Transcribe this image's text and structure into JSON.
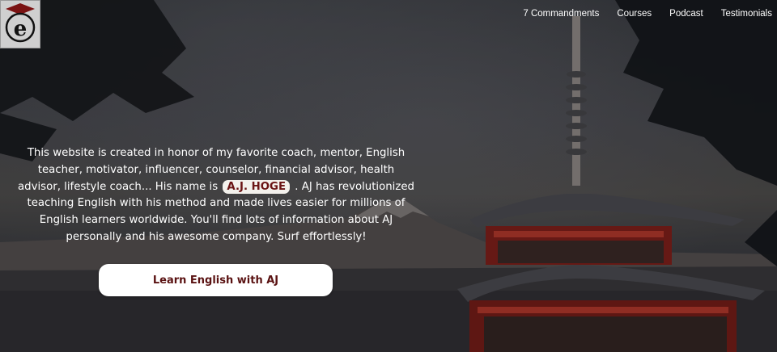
{
  "nav": {
    "items": [
      "7 Commandments",
      "Courses",
      "Podcast",
      "Testimonials"
    ]
  },
  "intro": {
    "before": "This website is created in honor of my favorite coach, mentor, English teacher, motivator, influencer, counselor, financial advisor, health advisor, lifestyle coach... His name is ",
    "name": "A.J. HOGE",
    "after": " . AJ has revolutionized teaching English with his method and made lives easier for millions of English learners worldwide. You'll find lots of information about AJ personally and his awesome company. Surf effortlessly!"
  },
  "cta": {
    "label": "Learn English with AJ"
  },
  "logo": {
    "icon": "graduation-cap-e-logo-icon"
  },
  "colors": {
    "accent": "#6b1414",
    "button_text": "#5a1212",
    "badge_bg": "#f4f1ec",
    "pagoda": "#b0281f"
  }
}
